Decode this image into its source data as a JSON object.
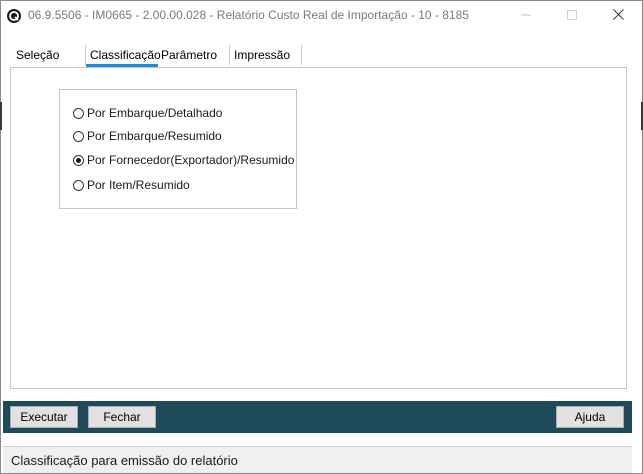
{
  "window": {
    "title": "06.9.5506 - IM0665 - 2.00.00.028 - Relatório Custo Real de Importação - 10 - 8185"
  },
  "tabs": [
    {
      "label": "Seleção",
      "active": false
    },
    {
      "label": "Classificação",
      "active": true
    },
    {
      "label": "Parâmetro",
      "active": false
    },
    {
      "label": "Impressão",
      "active": false
    }
  ],
  "options": [
    {
      "label": "Por Embarque/Detalhado",
      "checked": false
    },
    {
      "label": "Por Embarque/Resumido",
      "checked": false
    },
    {
      "label": "Por Fornecedor(Exportador)/Resumido",
      "checked": true
    },
    {
      "label": "Por Item/Resumido",
      "checked": false
    }
  ],
  "buttons": {
    "execute_label": "Executar",
    "close_label": "Fechar",
    "help_label": "Ajuda"
  },
  "status": {
    "text": "Classificação para emissão do relatório"
  },
  "colors": {
    "accent": "#1a8fd8",
    "bottom_bar": "#1f4a5a"
  },
  "icons": [
    "app-logo-icon",
    "minimize-icon",
    "maximize-icon",
    "close-icon"
  ]
}
